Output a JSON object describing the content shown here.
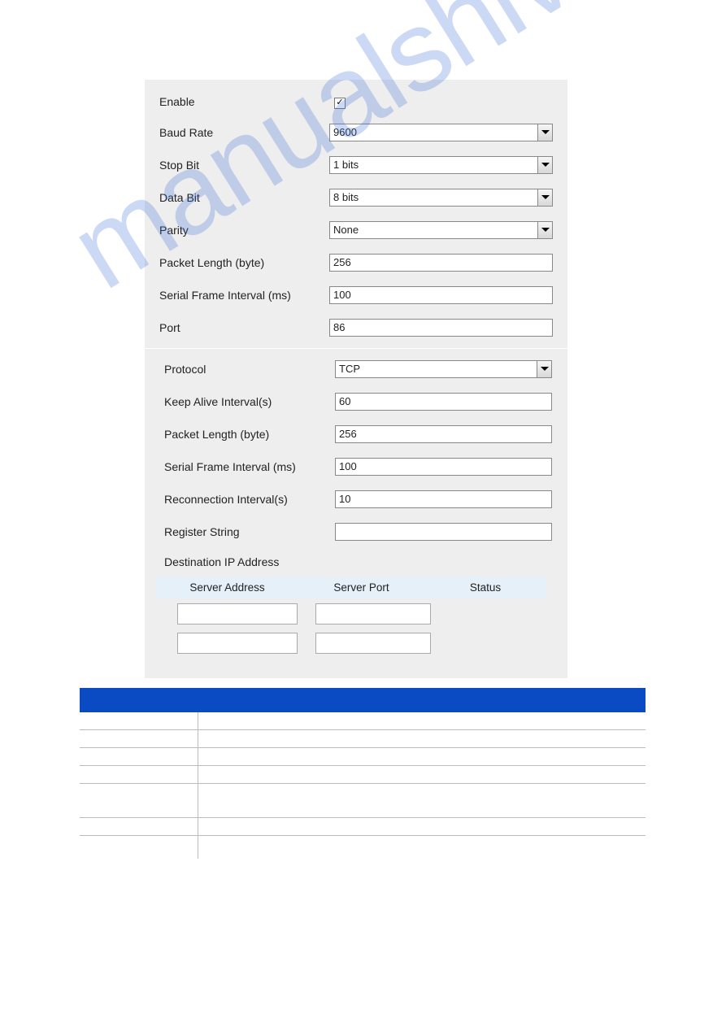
{
  "watermark": "manualshive.com",
  "form_top": {
    "enable": {
      "label": "Enable",
      "checked": true
    },
    "baud_rate": {
      "label": "Baud Rate",
      "value": "9600"
    },
    "stop_bit": {
      "label": "Stop Bit",
      "value": "1 bits"
    },
    "data_bit": {
      "label": "Data Bit",
      "value": "8 bits"
    },
    "parity": {
      "label": "Parity",
      "value": "None"
    },
    "packet_length": {
      "label": "Packet Length (byte)",
      "value": "256"
    },
    "frame_interval": {
      "label": "Serial Frame Interval (ms)",
      "value": "100"
    },
    "port": {
      "label": "Port",
      "value": "86"
    }
  },
  "form_bottom": {
    "protocol": {
      "label": "Protocol",
      "value": "TCP"
    },
    "keep_alive": {
      "label": "Keep Alive Interval(s)",
      "value": "60"
    },
    "packet_length": {
      "label": "Packet Length (byte)",
      "value": "256"
    },
    "frame_interval": {
      "label": "Serial Frame Interval (ms)",
      "value": "100"
    },
    "reconnection": {
      "label": "Reconnection Interval(s)",
      "value": "10"
    },
    "register_string": {
      "label": "Register String",
      "value": ""
    },
    "destination": {
      "title": "Destination IP Address",
      "headers": {
        "col1": "Server Address",
        "col2": "Server Port",
        "col3": "Status"
      },
      "rows": [
        {
          "address": "",
          "port": ""
        },
        {
          "address": "",
          "port": ""
        }
      ]
    }
  },
  "def_table": {
    "rows": [
      {
        "item": "",
        "desc": ""
      },
      {
        "item": "",
        "desc": ""
      },
      {
        "item": "",
        "desc": ""
      },
      {
        "item": "",
        "desc": ""
      },
      {
        "item": "",
        "desc": ""
      },
      {
        "item": "",
        "desc": ""
      },
      {
        "item": "",
        "desc": ""
      }
    ]
  }
}
